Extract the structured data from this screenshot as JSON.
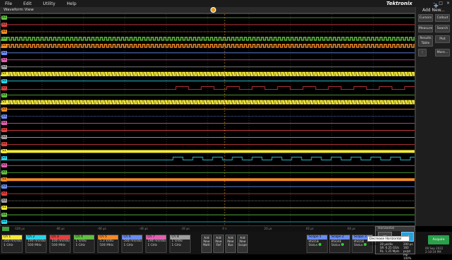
{
  "menu": {
    "file": "File",
    "edit": "Edit",
    "utility": "Utility",
    "help": "Help"
  },
  "brand": "Tektronix",
  "window_controls": [
    "–",
    "□",
    "×"
  ],
  "waveform_view": {
    "title": "Waveform View",
    "trigger_label": "T"
  },
  "toolbar": {
    "add_new": "Add New...",
    "cursors": "Cursors",
    "callout": "Callout",
    "measure": "Measure",
    "search": "Search",
    "results_table": "Results Table",
    "plot": "Plot",
    "more": "More..."
  },
  "timeline": [
    "-100 μs",
    "-80 μs",
    "-60 μs",
    "-40 μs",
    "-20 μs",
    "0 s",
    "20 μs",
    "40 μs",
    "60 μs"
  ],
  "channels": [
    {
      "name": "Ch 1",
      "color": "#f4e83a",
      "scale": "350 mV/div",
      "bw": "1 GHz"
    },
    {
      "name": "Ch 2",
      "color": "#2ad3e8",
      "scale": "190 mV/div",
      "bw": "500 MHz"
    },
    {
      "name": "Ch 3",
      "color": "#e04040",
      "scale": "100 mV/div",
      "bw": "500 MHz"
    },
    {
      "name": "Ch 4",
      "color": "#60c040",
      "scale": "1 V/div",
      "bw": "1 GHz"
    },
    {
      "name": "Ch 5",
      "color": "#f08a28",
      "scale": "5.3 V/div",
      "bw": "500 MHz"
    },
    {
      "name": "Ch 6",
      "color": "#6a8cf0",
      "scale": "500 mV/div",
      "bw": "1 GHz"
    },
    {
      "name": "Ch 7",
      "color": "#e060b0",
      "scale": "190 mV/div",
      "bw": "1 GHz"
    },
    {
      "name": "Ch 8",
      "color": "#a0a0a0",
      "scale": "1 V/div",
      "bw": "1 GHz"
    }
  ],
  "new_buttons": [
    {
      "l1": "Add",
      "l2": "New",
      "l3": "Math"
    },
    {
      "l1": "Add",
      "l2": "New",
      "l3": "Ref"
    },
    {
      "l1": "Add",
      "l2": "New",
      "l3": "Bus"
    },
    {
      "l1": "Add",
      "l2": "New",
      "l3": "Scope"
    }
  ],
  "scopes": [
    {
      "name": "Scope 1",
      "model": "MSO58",
      "status": "Status"
    },
    {
      "name": "Scope 2",
      "model": "MSO46",
      "status": "Status"
    },
    {
      "name": "Scope 3",
      "model": "MSO58",
      "status": "Status"
    }
  ],
  "horizontal": {
    "title": "Horizontal",
    "scale": "20 μs/div",
    "record": "200 μs",
    "sr": "SR: 6.25 GS/s",
    "rl": "RL: 1.25 Mpts",
    "pts": "160 ps/pt",
    "zoom": "mp 100%"
  },
  "tooltip": "Decrease Horizontal Scale",
  "acquire": "Acquire",
  "datetime": {
    "date": "09 Sep 2022",
    "time": "2:10:19 PM"
  },
  "row_labels": [
    "S1",
    "S1",
    "S1",
    "S1",
    "S1",
    "S1",
    "S1",
    "S1",
    "S1",
    "S1",
    "S1",
    "S1",
    "S1",
    "S1",
    "S1",
    "S1",
    "S1",
    "S1",
    "S1",
    "S1",
    "S1",
    "S1",
    "S1",
    "S1",
    "S1",
    "S1",
    "S1",
    "S1",
    "S1",
    "S1",
    "S1",
    "S1",
    "S1",
    "S1",
    "S1",
    "S1",
    "S1",
    "S1"
  ],
  "row_colors": [
    "#60c040",
    "#e04040",
    "#f08a28",
    "#60c040",
    "#f08a28",
    "#6a8cf0",
    "#e060b0",
    "#a0a0a0",
    "#f4e83a",
    "#2ad3e8",
    "#e04040",
    "#60c040",
    "#f4e83a",
    "#f08a28",
    "#6a8cf0",
    "#e060b0",
    "#e04040",
    "#a0a0a0",
    "#e04040",
    "#f4e83a",
    "#2ad3e8",
    "#e060b0",
    "#60c040",
    "#f08a28",
    "#6a8cf0",
    "#e04040",
    "#a0a0a0",
    "#f4e83a",
    "#60c040",
    "#2ad3e8"
  ]
}
